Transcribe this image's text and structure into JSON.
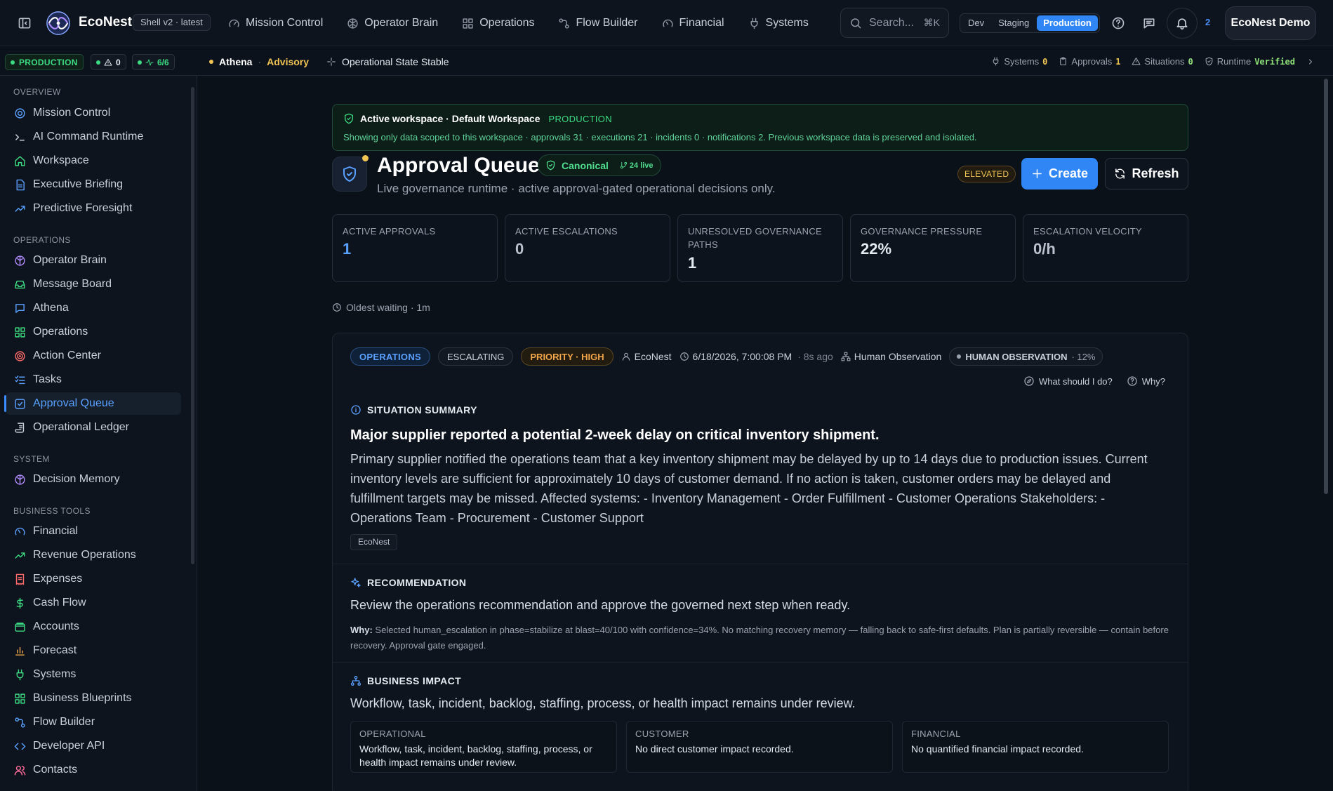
{
  "topnav": {
    "brand": "EcoNest",
    "shell_version": "Shell v2 · latest",
    "links": [
      {
        "label": "Mission Control",
        "icon": "gauge-icon"
      },
      {
        "label": "Operator Brain",
        "icon": "brain-icon"
      },
      {
        "label": "Operations",
        "icon": "grid-icon"
      },
      {
        "label": "Flow Builder",
        "icon": "workflow-icon"
      },
      {
        "label": "Financial",
        "icon": "gauge-icon"
      },
      {
        "label": "Systems",
        "icon": "plug-icon"
      }
    ],
    "search_placeholder": "Search...",
    "search_shortcut": "⌘K",
    "environments": [
      "Dev",
      "Staging",
      "Production"
    ],
    "active_environment": "Production",
    "notification_count": "2",
    "account": "EcoNest Demo"
  },
  "statusbar": {
    "environment": "PRODUCTION",
    "alerts": "0",
    "health": "6/6",
    "athena_name": "Athena",
    "athena_separator": "·",
    "athena_mode": "Advisory",
    "state": "Operational State Stable",
    "systems_label": "Systems",
    "systems_value": "0",
    "approvals_label": "Approvals",
    "approvals_value": "1",
    "situations_label": "Situations",
    "situations_value": "0",
    "runtime_label": "Runtime",
    "runtime_value": "Verified"
  },
  "sidebar": {
    "sections": [
      {
        "title": "OVERVIEW",
        "items": [
          {
            "label": "Mission Control",
            "icon": "gauge-icon"
          },
          {
            "label": "AI Command Runtime",
            "icon": "terminal-icon"
          },
          {
            "label": "Workspace",
            "icon": "home-icon"
          },
          {
            "label": "Executive Briefing",
            "icon": "document-icon"
          },
          {
            "label": "Predictive Foresight",
            "icon": "trending-up-icon"
          }
        ]
      },
      {
        "title": "OPERATIONS",
        "items": [
          {
            "label": "Operator Brain",
            "icon": "brain-icon"
          },
          {
            "label": "Message Board",
            "icon": "inbox-icon"
          },
          {
            "label": "Athena",
            "icon": "message-icon"
          },
          {
            "label": "Operations",
            "icon": "grid-icon"
          },
          {
            "label": "Action Center",
            "icon": "target-icon"
          },
          {
            "label": "Tasks",
            "icon": "list-checks-icon"
          },
          {
            "label": "Approval Queue",
            "icon": "check-square-icon",
            "active": true
          },
          {
            "label": "Operational Ledger",
            "icon": "scroll-icon"
          }
        ]
      },
      {
        "title": "SYSTEM",
        "items": [
          {
            "label": "Decision Memory",
            "icon": "brain-icon"
          }
        ]
      },
      {
        "title": "BUSINESS TOOLS",
        "items": [
          {
            "label": "Financial",
            "icon": "gauge-icon"
          },
          {
            "label": "Revenue Operations",
            "icon": "trending-up-icon"
          },
          {
            "label": "Expenses",
            "icon": "receipt-icon"
          },
          {
            "label": "Cash Flow",
            "icon": "dollar-icon"
          },
          {
            "label": "Accounts",
            "icon": "wallet-icon"
          },
          {
            "label": "Forecast",
            "icon": "bar-chart-icon"
          },
          {
            "label": "Systems",
            "icon": "plug-icon"
          },
          {
            "label": "Business Blueprints",
            "icon": "grid-icon"
          },
          {
            "label": "Flow Builder",
            "icon": "workflow-icon"
          },
          {
            "label": "Developer API",
            "icon": "code-icon"
          },
          {
            "label": "Contacts",
            "icon": "users-icon"
          }
        ]
      }
    ]
  },
  "workspace_banner": {
    "title": "Active workspace · Default Workspace",
    "environment": "PRODUCTION",
    "description": "Showing only data scoped to this workspace · approvals 31 · executions 21 · incidents 0 · notifications 2. Previous workspace data is preserved and isolated."
  },
  "page": {
    "title": "Approval Queue",
    "canonical_label": "Canonical",
    "live_count": "24 live",
    "subtitle": "Live governance runtime · active approval-gated operational decisions only.",
    "elevation": "ELEVATED",
    "create_label": "Create",
    "refresh_label": "Refresh",
    "oldest_waiting": "Oldest waiting · 1m"
  },
  "stats": [
    {
      "label": "ACTIVE APPROVALS",
      "value": "1"
    },
    {
      "label": "ACTIVE ESCALATIONS",
      "value": "0"
    },
    {
      "label": "UNRESOLVED GOVERNANCE PATHS",
      "value": "1"
    },
    {
      "label": "GOVERNANCE PRESSURE",
      "value": "22%"
    },
    {
      "label": "ESCALATION VELOCITY",
      "value": "0/h"
    }
  ],
  "situation": {
    "domain_tag": "OPERATIONS",
    "state_tag": "ESCALATING",
    "priority_tag": "PRIORITY · HIGH",
    "owner": "EcoNest",
    "timestamp": "6/18/2026, 7:00:08 PM",
    "ago": "· 8s ago",
    "source": "Human Observation",
    "observation_label": "HUMAN OBSERVATION",
    "observation_pct": "· 12%",
    "what_should_i_do": "What should I do?",
    "why": "Why?",
    "summary_heading": "SITUATION SUMMARY",
    "summary_title": "Major supplier reported a potential 2-week delay on critical inventory shipment.",
    "summary_body": "Primary supplier notified the operations team that a key inventory shipment may be delayed by up to 14 days due to production issues. Current inventory levels are sufficient for approximately 10 days of customer demand. If no action is taken, customer orders may be delayed and fulfillment targets may be missed. Affected systems: - Inventory Management - Order Fulfillment - Customer Operations Stakeholders: - Operations Team - Procurement - Customer Support",
    "source_chip": "EcoNest",
    "recommendation_heading": "RECOMMENDATION",
    "recommendation_text": "Review the operations recommendation and approve the governed next step when ready.",
    "why_label": "Why:",
    "why_text": "Selected human_escalation in phase=stabilize at blast=40/100 with confidence=34%. No matching recovery memory — falling back to safe-first defaults. Plan is partially reversible — contain before recovery. Approval gate engaged.",
    "impact_heading": "BUSINESS IMPACT",
    "impact_text": "Workflow, task, incident, backlog, staffing, process, or health impact remains under review.",
    "impact_cards": [
      {
        "label": "OPERATIONAL",
        "value": "Workflow, task, incident, backlog, staffing, process, or health impact remains under review."
      },
      {
        "label": "CUSTOMER",
        "value": "No direct customer impact recorded."
      },
      {
        "label": "FINANCIAL",
        "value": "No quantified financial impact recorded."
      }
    ]
  },
  "colors": {
    "accent": "#2f86f4",
    "success": "#3ddc84",
    "warning": "#f1c453",
    "background": "#0b1119"
  }
}
